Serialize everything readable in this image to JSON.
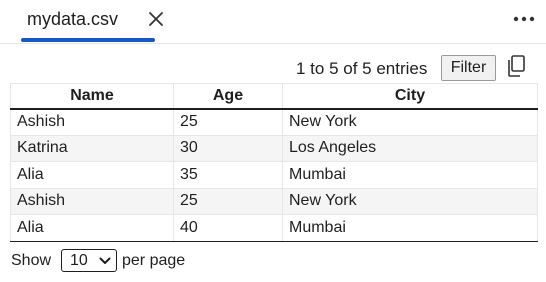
{
  "tab": {
    "title": "mydata.csv",
    "close_icon": "close-icon",
    "more_icon": "more-horizontal-icon"
  },
  "toolbar": {
    "info": "1 to 5 of 5 entries",
    "filter_label": "Filter",
    "copy_icon": "copy-icon"
  },
  "table": {
    "columns": [
      "Name",
      "Age",
      "City"
    ],
    "rows": [
      [
        "Ashish",
        "25",
        "New York"
      ],
      [
        "Katrina",
        "30",
        "Los Angeles"
      ],
      [
        "Alia",
        "35",
        "Mumbai"
      ],
      [
        "Ashish",
        "25",
        "New York"
      ],
      [
        "Alia",
        "40",
        "Mumbai"
      ]
    ]
  },
  "footer": {
    "show_label": "Show",
    "page_size": "10",
    "per_page_label": "per page"
  },
  "colors": {
    "accent": "#1a56c4",
    "stripe": "#f5f5f5",
    "text": "#1f1f1f"
  }
}
